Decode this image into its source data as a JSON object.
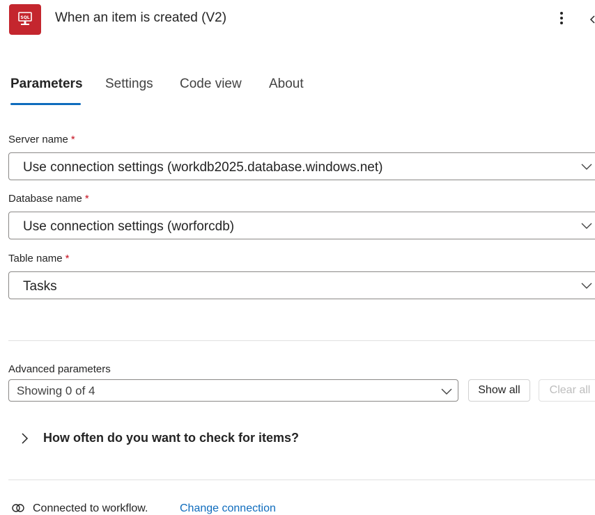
{
  "header": {
    "title": "When an item is created (V2)",
    "icon_name": "sql-server-icon",
    "icon_text": "SQL",
    "accent_color": "#c4262e"
  },
  "tabs": [
    {
      "label": "Parameters",
      "active": true
    },
    {
      "label": "Settings",
      "active": false
    },
    {
      "label": "Code view",
      "active": false
    },
    {
      "label": "About",
      "active": false
    }
  ],
  "fields": {
    "server": {
      "label": "Server name",
      "required_mark": "*",
      "value": "Use connection settings (workdb2025.database.windows.net)"
    },
    "database": {
      "label": "Database name",
      "required_mark": "*",
      "value": "Use connection settings (worforcdb)"
    },
    "table": {
      "label": "Table name",
      "required_mark": "*",
      "value": "Tasks"
    }
  },
  "advanced": {
    "label": "Advanced parameters",
    "value": "Showing 0 of 4",
    "show_all": "Show all",
    "clear_all": "Clear all"
  },
  "section": {
    "title": "How often do you want to check for items?"
  },
  "connection": {
    "status": "Connected to workflow.",
    "change_link": "Change connection"
  },
  "colors": {
    "tab_indicator": "#0f6cbd",
    "required": "#c50f1f",
    "link": "#0f6cbd"
  }
}
